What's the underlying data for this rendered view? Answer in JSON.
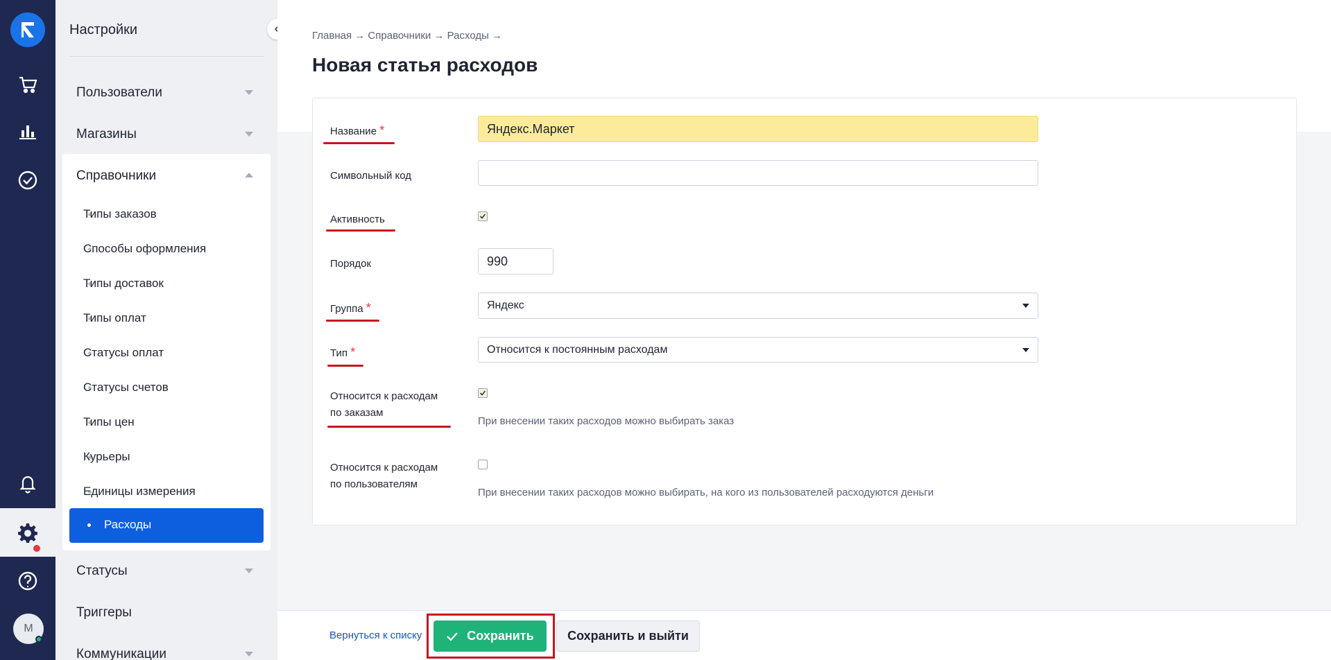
{
  "sidebar": {
    "title": "Настройки",
    "items": [
      {
        "label": "Пользователи"
      },
      {
        "label": "Магазины"
      },
      {
        "label": "Справочники"
      },
      {
        "label": "Статусы"
      },
      {
        "label": "Триггеры"
      },
      {
        "label": "Коммуникации"
      }
    ],
    "sub_items": [
      {
        "label": "Типы заказов"
      },
      {
        "label": "Способы оформления"
      },
      {
        "label": "Типы доставок"
      },
      {
        "label": "Типы оплат"
      },
      {
        "label": "Статусы оплат"
      },
      {
        "label": "Статусы счетов"
      },
      {
        "label": "Типы цен"
      },
      {
        "label": "Курьеры"
      },
      {
        "label": "Единицы измерения"
      },
      {
        "label": "Расходы"
      }
    ]
  },
  "rail": {
    "avatar_initial": "М",
    "icons": [
      "logo-icon",
      "cart-icon",
      "analytics-icon",
      "tasks-check-icon",
      "bell-icon",
      "gear-icon",
      "help-icon"
    ]
  },
  "header": {
    "breadcrumb": "Главная → Справочники → Расходы →",
    "title": "Новая статья расходов"
  },
  "form": {
    "name_label": "Название",
    "name_value": "Яндекс.Маркет",
    "code_label": "Символьный код",
    "code_value": "",
    "active_label": "Активность",
    "order_label": "Порядок",
    "order_value": "990",
    "group_label": "Группа",
    "group_value": "Яндекс",
    "type_label": "Тип",
    "type_value": "Относится к постоянным расходам",
    "orders_label_1": "Относится к расходам",
    "orders_label_2": "по заказам",
    "orders_hint": "При внесении таких расходов можно выбирать заказ",
    "users_label_1": "Относится к расходам",
    "users_label_2": "по пользователям",
    "users_hint": "При внесении таких расходов можно выбирать, на кого из пользователей расходуются деньги",
    "required_mark": "*"
  },
  "footer": {
    "back_label": "Вернуться к списку",
    "save_label": "Сохранить",
    "save_exit_label": "Сохранить и выйти"
  },
  "colors": {
    "rail_bg": "#1e2851",
    "accent_blue": "#0d5fe0",
    "save_green": "#1fb37a",
    "highlight_yellow": "#fdeb9c",
    "annotation_red": "#c8151f"
  }
}
